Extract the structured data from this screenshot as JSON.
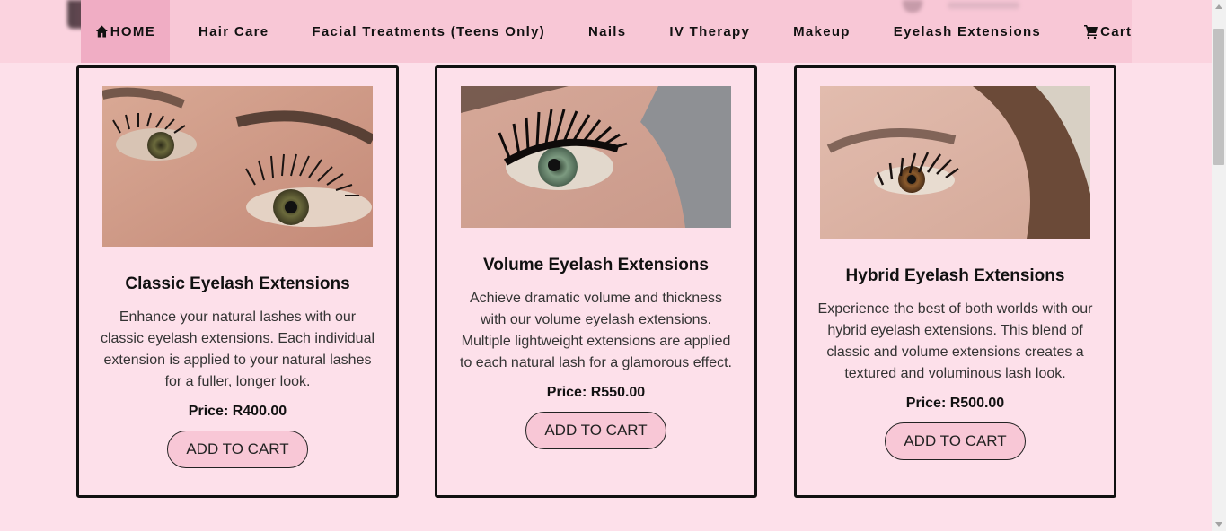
{
  "nav": {
    "items": [
      {
        "label": "HOME",
        "icon": "home-icon"
      },
      {
        "label": "Hair Care"
      },
      {
        "label": "Facial Treatments (Teens Only)"
      },
      {
        "label": "Nails"
      },
      {
        "label": "IV Therapy"
      },
      {
        "label": "Makeup"
      },
      {
        "label": "Eyelash Extensions"
      },
      {
        "label": "Cart",
        "icon": "cart-icon"
      }
    ]
  },
  "products": [
    {
      "title": "Classic Eyelash Extensions",
      "description": "Enhance your natural lashes with our classic eyelash extensions. Each individual extension is applied to your natural lashes for a fuller, longer look.",
      "price": "Price: R400.00",
      "button": "ADD TO CART",
      "image": "close-up photo of eye with classic lash extensions"
    },
    {
      "title": "Volume Eyelash Extensions",
      "description": "Achieve dramatic volume and thickness with our volume eyelash extensions. Multiple lightweight extensions are applied to each natural lash for a glamorous effect.",
      "price": "Price: R550.00",
      "button": "ADD TO CART",
      "image": "close-up photo of green eye with volume lash extensions"
    },
    {
      "title": "Hybrid Eyelash Extensions",
      "description": "Experience the best of both worlds with our hybrid eyelash extensions. This blend of classic and volume extensions creates a textured and voluminous lash look.",
      "price": "Price: R500.00",
      "button": "ADD TO CART",
      "image": "close-up photo of brown eye with hybrid lash extensions"
    }
  ],
  "colors": {
    "page_bg": "#fde0ea",
    "nav_bg": "#f8c7d6",
    "nav_active": "#f0adc4",
    "button_bg": "#f8c7d6"
  }
}
